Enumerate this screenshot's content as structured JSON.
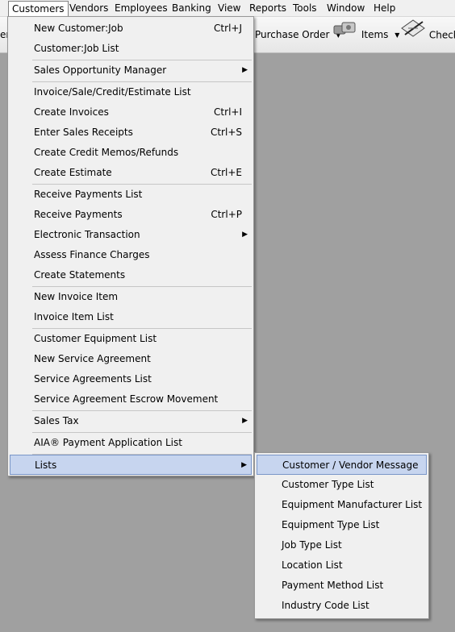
{
  "menubar": [
    {
      "label": "Customers",
      "open": true
    },
    {
      "label": "Vendors"
    },
    {
      "label": "Employees"
    },
    {
      "label": "Banking"
    },
    {
      "label": "View"
    },
    {
      "label": "Reports"
    },
    {
      "label": "Tools"
    },
    {
      "label": "Window"
    },
    {
      "label": "Help"
    }
  ],
  "toolbar": {
    "cut_label": "er",
    "purchase_order": "Purchase Order",
    "items": "Items",
    "check": "Check"
  },
  "customers_menu": [
    {
      "label": "New Customer:Job",
      "shortcut": "Ctrl+J"
    },
    {
      "label": "Customer:Job List"
    },
    {
      "label": "Sales Opportunity Manager",
      "submenu": true
    },
    {
      "label": "Invoice/Sale/Credit/Estimate List"
    },
    {
      "label": "Create Invoices",
      "shortcut": "Ctrl+I"
    },
    {
      "label": "Enter Sales Receipts",
      "shortcut": "Ctrl+S"
    },
    {
      "label": "Create Credit Memos/Refunds"
    },
    {
      "label": "Create Estimate",
      "shortcut": "Ctrl+E"
    },
    {
      "label": "Receive Payments List"
    },
    {
      "label": "Receive Payments",
      "shortcut": "Ctrl+P"
    },
    {
      "label": "Electronic Transaction",
      "submenu": true
    },
    {
      "label": "Assess Finance Charges"
    },
    {
      "label": "Create Statements"
    },
    {
      "label": "New Invoice Item"
    },
    {
      "label": "Invoice Item List"
    },
    {
      "label": "Customer Equipment List"
    },
    {
      "label": "New Service Agreement"
    },
    {
      "label": "Service Agreements List"
    },
    {
      "label": "Service Agreement Escrow Movement"
    },
    {
      "label": "Sales Tax",
      "submenu": true
    },
    {
      "label": "AIA® Payment Application List"
    },
    {
      "label": "Lists",
      "submenu": true,
      "highlighted": true
    }
  ],
  "lists_submenu": [
    {
      "label": "Customer / Vendor Message",
      "highlighted": true
    },
    {
      "label": "Customer Type List"
    },
    {
      "label": "Equipment Manufacturer List"
    },
    {
      "label": "Equipment Type List"
    },
    {
      "label": "Job Type List"
    },
    {
      "label": "Location List"
    },
    {
      "label": "Payment Method List"
    },
    {
      "label": "Industry Code List"
    }
  ]
}
